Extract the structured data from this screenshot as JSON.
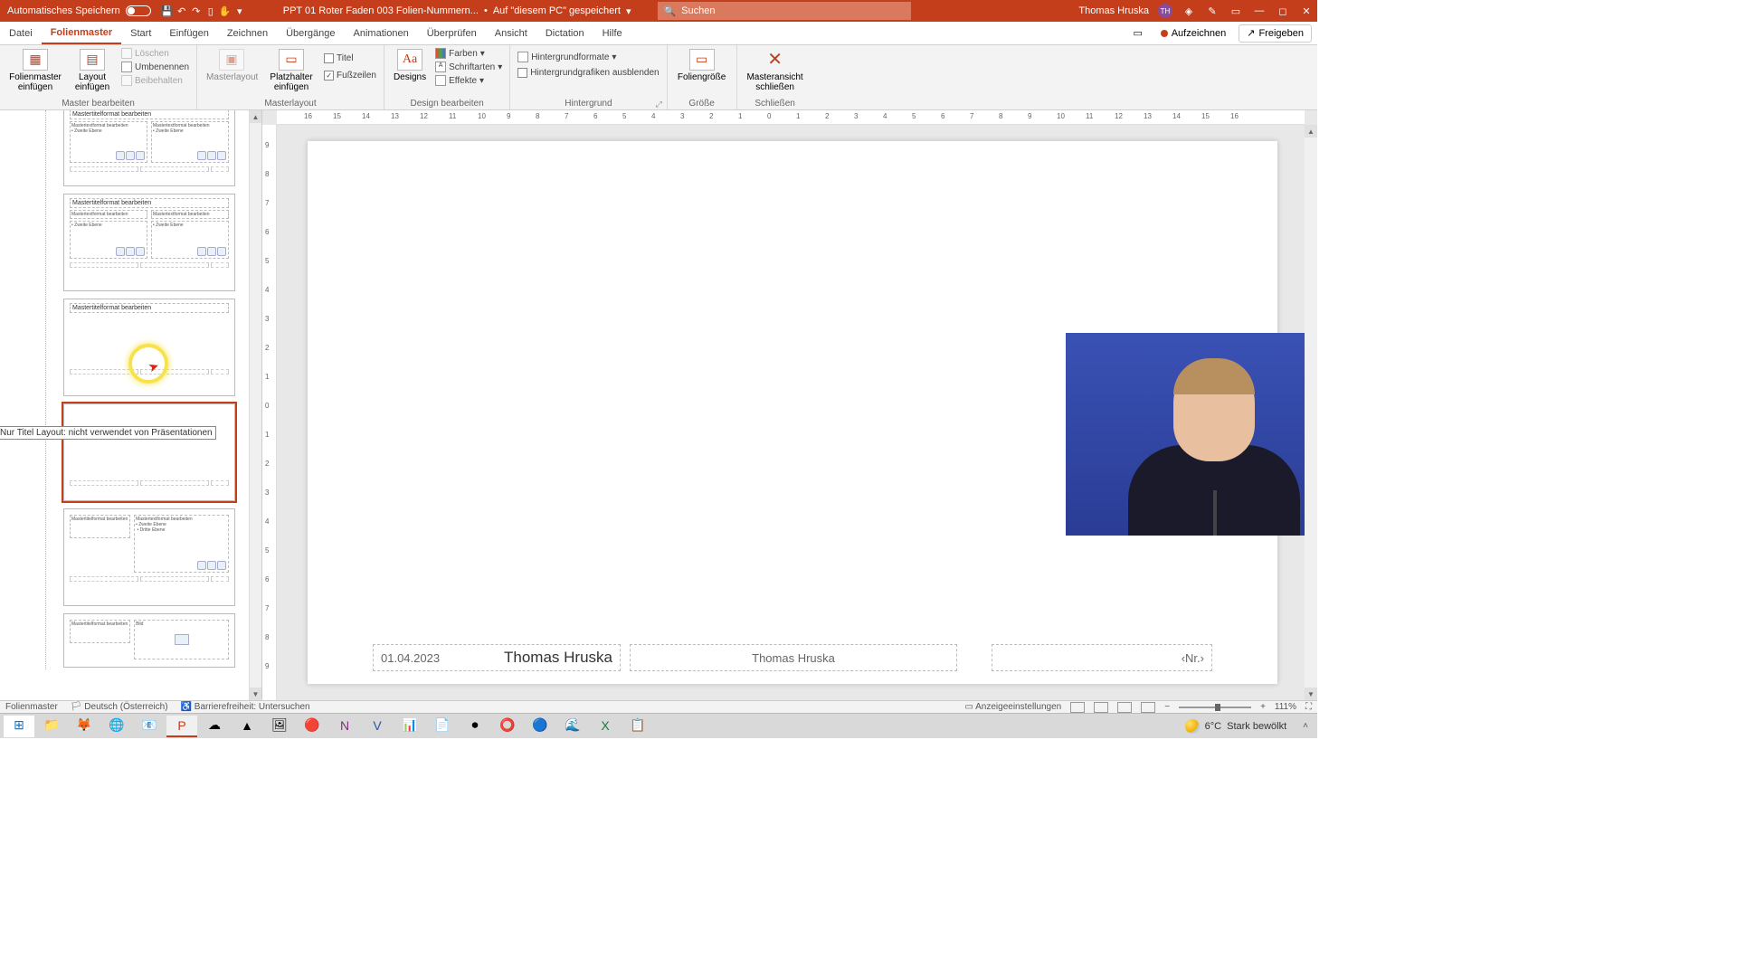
{
  "titlebar": {
    "autosave_label": "Automatisches Speichern",
    "doc_name": "PPT 01 Roter Faden 003 Folien-Nummern...",
    "saved_hint": "Auf \"diesem PC\" gespeichert",
    "search_placeholder": "Suchen",
    "user_name": "Thomas Hruska",
    "user_initials": "TH"
  },
  "tabs": {
    "items": [
      "Datei",
      "Folienmaster",
      "Start",
      "Einfügen",
      "Zeichnen",
      "Übergänge",
      "Animationen",
      "Überprüfen",
      "Ansicht",
      "Dictation",
      "Hilfe"
    ],
    "active_index": 1,
    "record": "Aufzeichnen",
    "share": "Freigeben"
  },
  "ribbon": {
    "g1": {
      "insert_master": "Folienmaster einfügen",
      "insert_layout": "Layout einfügen",
      "delete": "Löschen",
      "rename": "Umbenennen",
      "preserve": "Beibehalten",
      "label": "Master bearbeiten"
    },
    "g2": {
      "masterlayout": "Masterlayout",
      "placeholder": "Platzhalter einfügen",
      "chk_title": "Titel",
      "chk_footers": "Fußzeilen",
      "label": "Masterlayout"
    },
    "g3": {
      "themes": "Designs",
      "colors": "Farben",
      "fonts": "Schriftarten",
      "effects": "Effekte",
      "label": "Design bearbeiten"
    },
    "g4": {
      "bg_styles": "Hintergrundformate",
      "hide_bg": "Hintergrundgrafiken ausblenden",
      "label": "Hintergrund"
    },
    "g5": {
      "slide_size": "Foliengröße",
      "label": "Größe"
    },
    "g6": {
      "close": "Masteransicht schließen",
      "label": "Schließen"
    }
  },
  "ruler": {
    "h": [
      "16",
      "15",
      "14",
      "13",
      "12",
      "11",
      "10",
      "9",
      "8",
      "7",
      "6",
      "5",
      "4",
      "3",
      "2",
      "1",
      "0",
      "1",
      "2",
      "3",
      "4",
      "5",
      "6",
      "7",
      "8",
      "9",
      "10",
      "11",
      "12",
      "13",
      "14",
      "15",
      "16"
    ],
    "v": [
      "9",
      "8",
      "7",
      "6",
      "5",
      "4",
      "3",
      "2",
      "1",
      "0",
      "1",
      "2",
      "3",
      "4",
      "5",
      "6",
      "7",
      "8",
      "9"
    ]
  },
  "thumbs": {
    "placeholder_title": "Mastertitelformat bearbeiten",
    "placeholder_text": "Mastertextformat bearbeiten",
    "bullet2": "Zweite Ebene",
    "bullet3": "Dritte Ebene",
    "pic_label": "Bild",
    "tooltip": "Nur Titel Layout: nicht verwendet von Präsentationen"
  },
  "slide": {
    "date": "01.04.2023",
    "date_author": "Thomas Hruska",
    "footer": "Thomas Hruska",
    "slide_num": "‹Nr.›"
  },
  "status": {
    "view": "Folienmaster",
    "lang": "Deutsch (Österreich)",
    "a11y": "Barrierefreiheit: Untersuchen",
    "display": "Anzeigeeinstellungen",
    "zoom": "111%"
  },
  "taskbar": {
    "temp": "6°C",
    "weather": "Stark bewölkt"
  }
}
